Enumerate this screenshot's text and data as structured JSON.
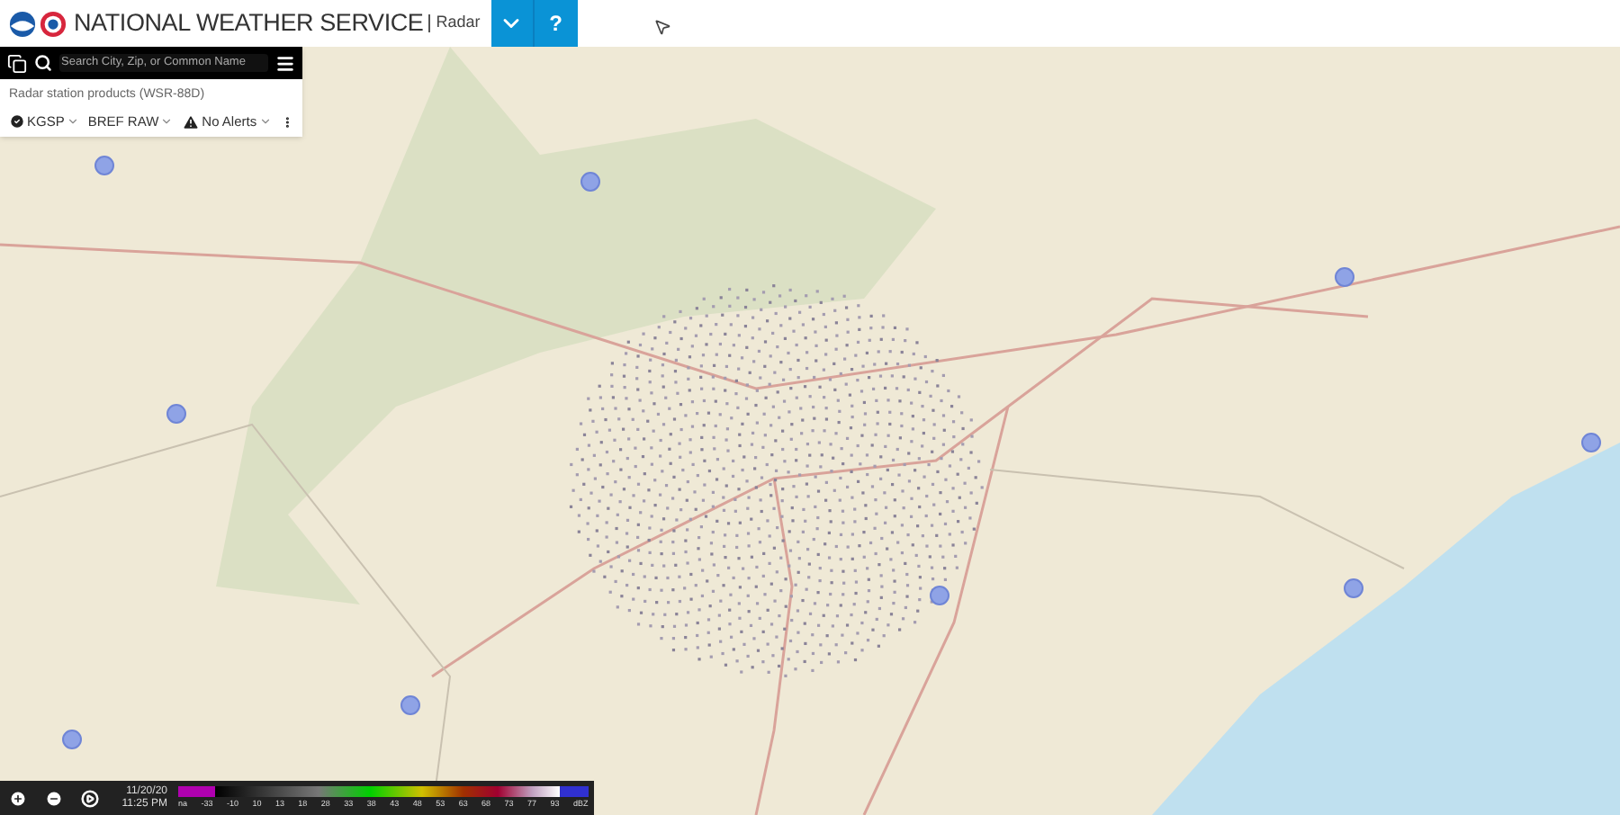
{
  "header": {
    "title": "NATIONAL WEATHER SERVICE",
    "subtitle": "Radar",
    "buttons": [
      {
        "kind": "dropdown"
      },
      {
        "kind": "help",
        "label": "?"
      }
    ]
  },
  "panel": {
    "search": {
      "placeholder": "Search City, Zip, or Common Name"
    },
    "heading": "Radar station products (WSR-88D)",
    "station": "KGSP",
    "product": "BREF RAW",
    "alerts": "No Alerts"
  },
  "player": {
    "date": "11/20/20",
    "time": "11:25 PM"
  },
  "legend": {
    "labels": [
      "na",
      "-33",
      "-10",
      "10",
      "13",
      "18",
      "28",
      "33",
      "38",
      "43",
      "48",
      "53",
      "63",
      "68",
      "73",
      "77",
      "93",
      "dBZ"
    ]
  }
}
